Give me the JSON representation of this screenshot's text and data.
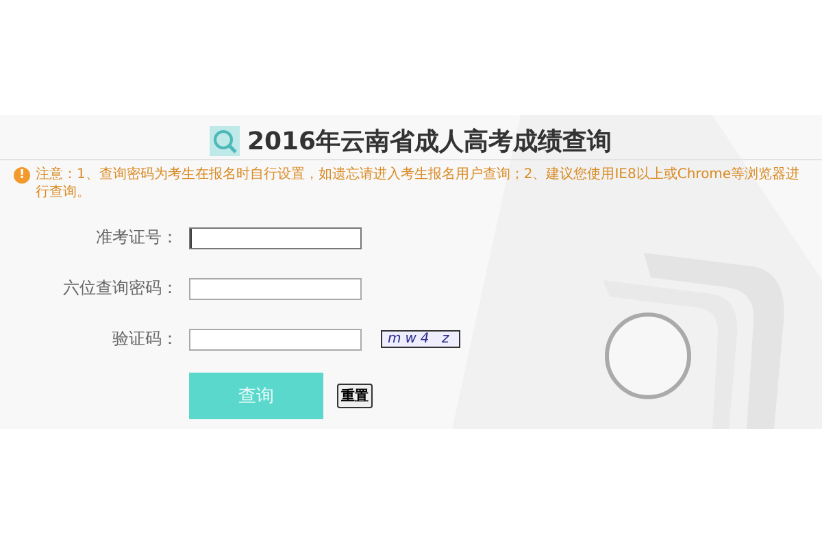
{
  "title": "2016年云南省成人高考成绩查询",
  "notice": {
    "icon": "!",
    "text": "注意：1、查询密码为考生在报名时自行设置，如遗忘请进入考生报名用户查询；2、建议您使用IE8以上或Chrome等浏览器进行查询。"
  },
  "fields": [
    {
      "label": "准考证号：",
      "focused": true
    },
    {
      "label": "六位查询密码：",
      "focused": false
    },
    {
      "label": "验证码：",
      "focused": false,
      "captcha": "mw4 z"
    }
  ],
  "buttons": {
    "submit": "查询",
    "reset": "重置"
  }
}
